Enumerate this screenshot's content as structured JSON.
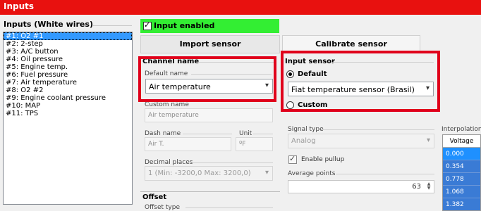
{
  "window": {
    "title": "Inputs"
  },
  "inputs": {
    "header": "Inputs (White wires)",
    "items": [
      "#1: O2 #1",
      "#2: 2-step",
      "#3: A/C button",
      "#4: Oil pressure",
      "#5: Engine temp.",
      "#6: Fuel pressure",
      "#7: Air temperature",
      "#8: O2 #2",
      "#9: Engine coolant pressure",
      "#10: MAP",
      "#11: TPS"
    ]
  },
  "enable": {
    "label": "Input enabled",
    "checked": true
  },
  "buttons": {
    "import": "Import sensor",
    "calibrate": "Calibrate sensor"
  },
  "channel": {
    "header": "Channel name",
    "default_label": "Default name",
    "default_value": "Air temperature",
    "custom_label": "Custom name",
    "custom_value": "Air temperature",
    "dash_label": "Dash name",
    "dash_value": "Air T.",
    "unit_label": "Unit",
    "unit_value": "ºF",
    "decimal_label": "Decimal places",
    "decimal_value": "1 (Min: -3200,0 Max: 3200,0)"
  },
  "offset": {
    "header": "Offset",
    "type_label": "Offset type"
  },
  "sensor": {
    "header": "Input sensor",
    "default_label": "Default",
    "default_value": "Fiat temperature sensor (Brasil)",
    "custom_label": "Custom",
    "selected": "Default"
  },
  "signal": {
    "type_label": "Signal type",
    "type_value": "Analog",
    "pullup_label": "Enable pullup",
    "pullup_checked": true,
    "avg_label": "Average points",
    "avg_value": "63"
  },
  "interp": {
    "label": "Interpolation",
    "column": "Voltage",
    "values": [
      "0.000",
      "0.354",
      "0.778",
      "1.068",
      "1.382"
    ]
  },
  "colors": {
    "titlebar": "#e8110f",
    "enabled_bg": "#33ee33",
    "highlight": "#e0001b",
    "selection": "#3399ff"
  }
}
